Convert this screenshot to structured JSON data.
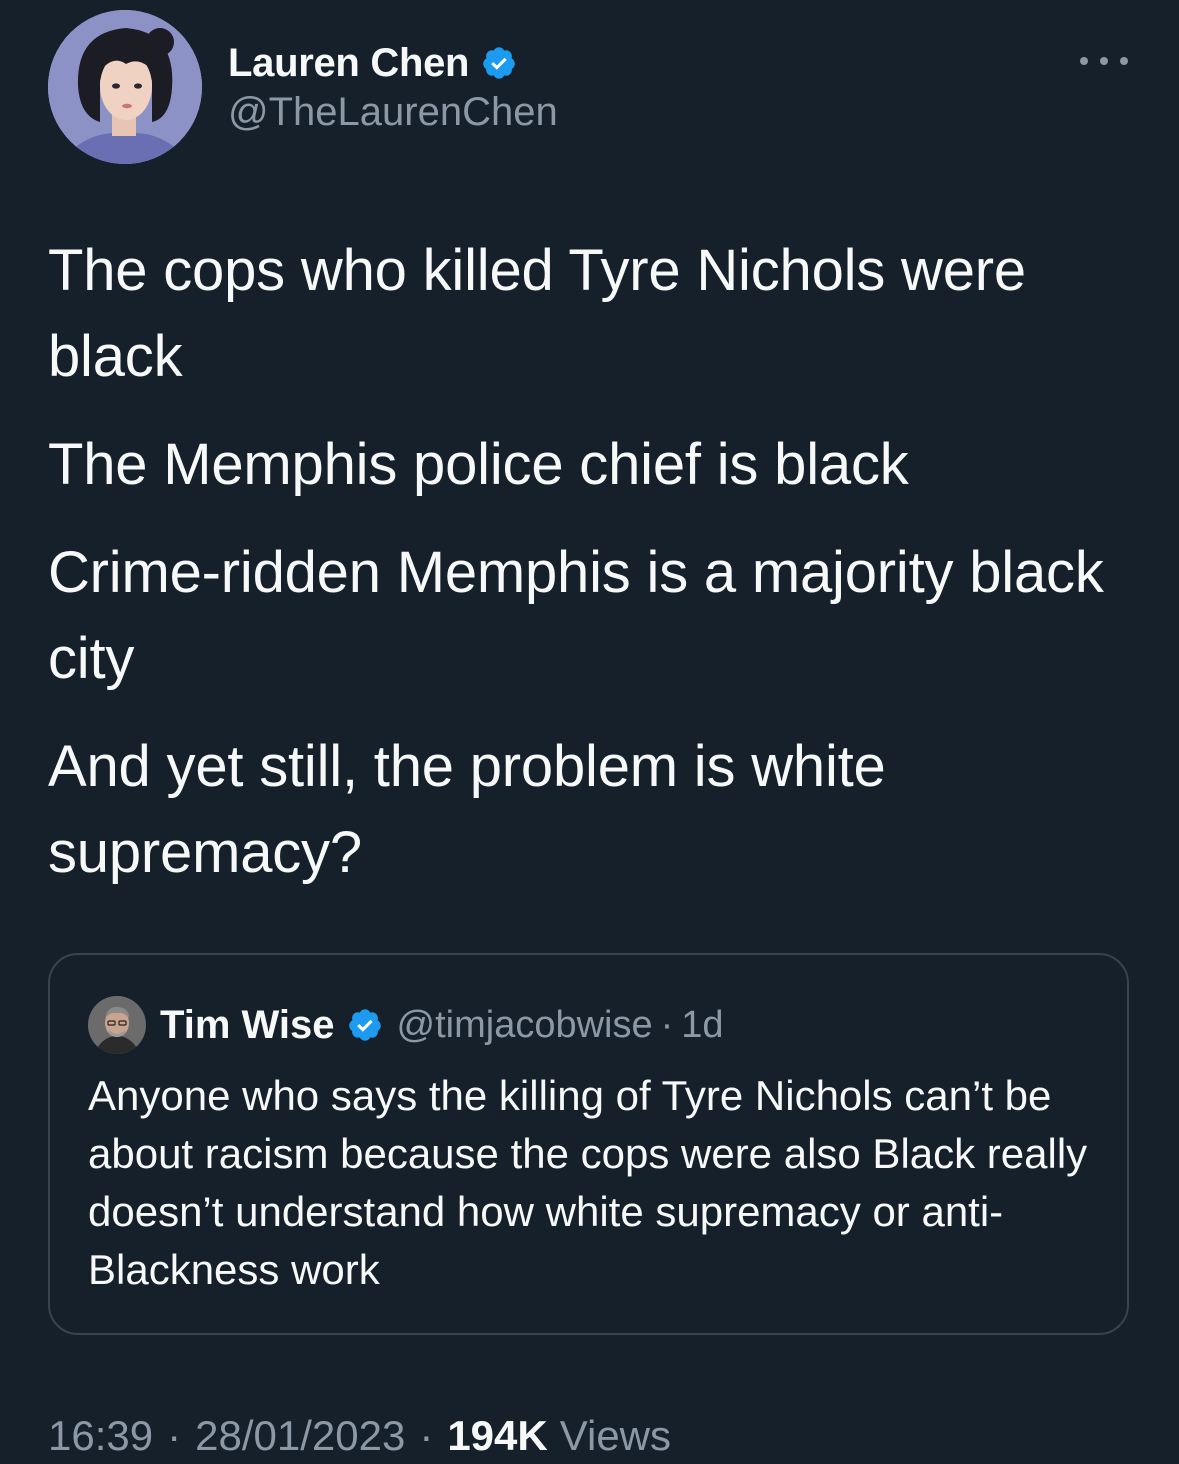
{
  "tweet": {
    "author": {
      "name": "Lauren Chen",
      "handle": "@TheLaurenChen",
      "verified": true,
      "avatar_icon": "profile-avatar-illustrated-woman"
    },
    "more_icon": "ellipsis-horizontal-icon",
    "paragraphs": [
      "The cops who killed Tyre Nichols were black",
      "The Memphis police chief is black",
      "Crime-ridden Memphis is a majority black city",
      "And yet still, the problem is white supremacy?"
    ],
    "quoted_tweet": {
      "author_name": "Tim Wise",
      "handle": "@timjacobwise",
      "separator": "·",
      "time": "1d",
      "verified": true,
      "text": "Anyone who says the killing of Tyre Nichols can’t be about racism because the cops were also Black really doesn’t understand how white supremacy or anti-Blackness work"
    },
    "meta": {
      "time": "16:39",
      "separator_1": "·",
      "date": "28/01/2023",
      "separator_2": "·",
      "views_count": "194K",
      "views_label": "Views"
    }
  },
  "colors": {
    "background": "#15202b",
    "text_primary": "#f7f9f9",
    "text_secondary": "#8b98a5",
    "border": "#38444d",
    "verified_blue": "#1d9bf0"
  }
}
